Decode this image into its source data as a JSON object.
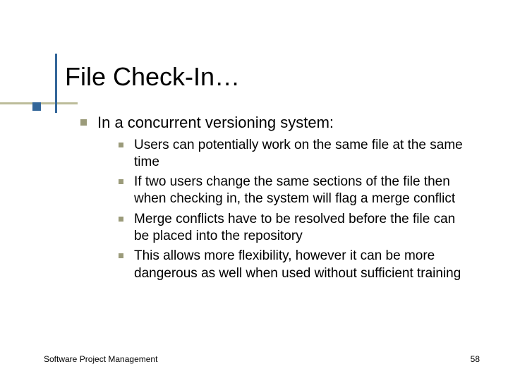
{
  "title": "File Check-In…",
  "top_item": "In a concurrent versioning system:",
  "sub_items": [
    "Users can potentially work on the same file at the same time",
    "If two users change the same sections of the file then when checking in, the system will flag a merge conflict",
    "Merge conflicts have to be resolved before the file can be placed into the repository",
    "This allows more flexibility, however it can be more dangerous as well when used without sufficient training"
  ],
  "footer": {
    "left": "Software Project Management",
    "right": "58"
  },
  "colors": {
    "accent_blue": "#336699",
    "accent_olive": "#9b9b7a"
  }
}
